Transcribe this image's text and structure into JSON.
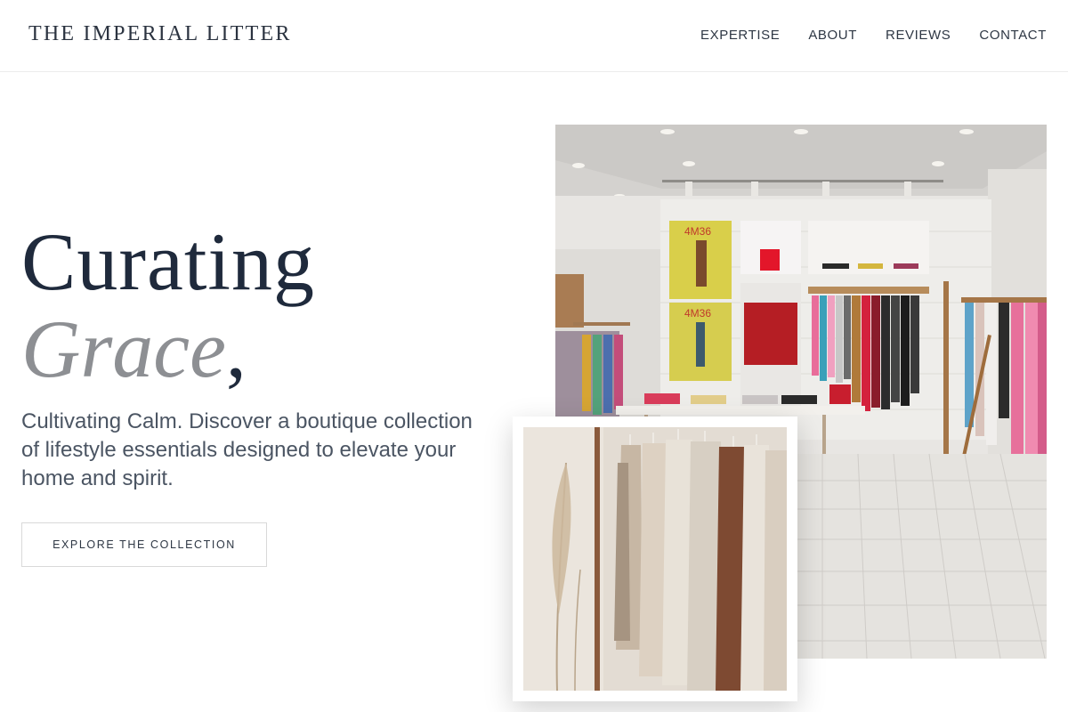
{
  "header": {
    "brand": "THE IMPERIAL LITTER",
    "nav": [
      {
        "label": "EXPERTISE"
      },
      {
        "label": "ABOUT"
      },
      {
        "label": "REVIEWS"
      },
      {
        "label": "CONTACT"
      }
    ]
  },
  "hero": {
    "headline_line1": "Curating",
    "headline_line2": "Grace",
    "headline_punct": ",",
    "subtitle": "Cultivating Calm. Discover a boutique collection of lifestyle essentials designed to elevate your home and spirit.",
    "cta_label": "EXPLORE THE COLLECTION"
  },
  "images": {
    "main_alt": "Bright boutique clothing store interior",
    "main_poster_text": "4M36",
    "card_alt": "Neutral knitwear on a clothing rack with dried pampas grass"
  },
  "colors": {
    "headline": "#1f2a3c",
    "accent_italic": "#8d8f93",
    "body_text": "#4b5563"
  }
}
